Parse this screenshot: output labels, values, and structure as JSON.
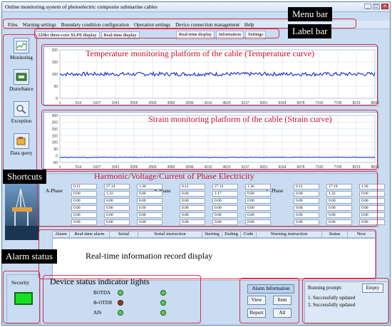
{
  "window": {
    "title": "Online monitoring system of photoelectric composite submarine cables",
    "buttons": [
      "_",
      "□",
      "×"
    ]
  },
  "menu": {
    "items": [
      "Files",
      "Warning settings",
      "Boundary condition configuration",
      "Operation settings",
      "Device connection management",
      "Help"
    ]
  },
  "tabs": {
    "items": [
      "220kv three-core XLPE display",
      "Real-time display"
    ],
    "items2": [
      "Real-time display",
      "Information",
      "Settings"
    ]
  },
  "sidebar": {
    "items": [
      {
        "label": "Monitoring",
        "icon": "monitoring-chart-icon"
      },
      {
        "label": "Disturbance",
        "icon": "disturbance-icon"
      },
      {
        "label": "Exception",
        "icon": "exception-magnifier-icon"
      },
      {
        "label": "Data query",
        "icon": "data-query-icon"
      }
    ]
  },
  "callouts": {
    "menu_bar": "Menu bar",
    "label_bar": "Label bar",
    "shortcuts": "Shortcuts",
    "alarm_status": "Alarm status",
    "realtime_record": "Real-time information record display",
    "device_lights": "Device status indicator lights"
  },
  "overlay_titles": {
    "temperature": "Temperature monitoring platform of the cable (Temperature curve)",
    "strain": "Strain monitoring platform of the cable (Strain curve)",
    "harmonic": "Harmonic/Voltage/Current of Phase Electricity"
  },
  "chart_data": [
    {
      "type": "line",
      "y_ticks": [
        "200",
        "150",
        "100",
        "50",
        "0"
      ],
      "ylim": [
        0,
        200
      ],
      "x_ticks": [
        "1",
        "514",
        "1027",
        "1541",
        "2055",
        "2569",
        "3082",
        "3596",
        "4110",
        "4623",
        "5137",
        "5651",
        "6164",
        "6678",
        "7192",
        "7705",
        "8219",
        "8830"
      ],
      "series": [
        {
          "color": "#1f2fd0",
          "level": 100,
          "spread": 8
        }
      ],
      "grid": true
    },
    {
      "type": "line",
      "y_ticks": [
        "300",
        "250",
        "200",
        "150",
        "100",
        "50",
        "0",
        "-50"
      ],
      "ylim": [
        -50,
        300
      ],
      "x_ticks": [
        "1",
        "514",
        "1027",
        "1541",
        "2055",
        "2569",
        "3082",
        "3596",
        "4110",
        "4623",
        "5137",
        "5651",
        "6164",
        "6678",
        "7192",
        "7705",
        "8219",
        "8830"
      ],
      "series": [
        {
          "color": "#1f2fd0",
          "level": -12,
          "spread": 2
        }
      ],
      "grid": true
    }
  ],
  "phases": {
    "labels": [
      "A-Phase",
      "B-Phase",
      "C-Phase"
    ],
    "a_col1": [
      "0.12",
      "0.00",
      "0.00",
      "0.00",
      "0.00",
      "0.00"
    ],
    "a_col2": [
      "27.14",
      "1.33",
      "0.00",
      "0.00",
      "0.00",
      "0.00"
    ],
    "a_col3": [
      "1.36",
      "0.00",
      "0.00",
      "0.00",
      "0.00",
      "0.00"
    ],
    "b_col1": [
      "0.12",
      "0.00",
      "0.00",
      "0.00",
      "0.00",
      "0.00"
    ],
    "b_col2": [
      "27.13",
      "1.17",
      "0.00",
      "0.00",
      "0.00",
      "0.00"
    ],
    "b_col3": [
      "1.36",
      "0.00",
      "0.00",
      "0.00",
      "0.00",
      "0.00"
    ],
    "c_col1": [
      "0.12",
      "0.00",
      "0.00",
      "0.00",
      "0.00",
      "0.00"
    ],
    "c_col2": [
      "27.19",
      "1.32",
      "0.00",
      "0.00",
      "0.00",
      "0.00"
    ],
    "c_col3": [
      "1.36",
      "0.00",
      "0.00",
      "0.00",
      "0.00",
      "0.00"
    ]
  },
  "alarm_table": {
    "columns": [
      "Alarm",
      "Real-time alarm",
      "Serial",
      "Serial instruction",
      "Starting",
      "Ending",
      "Code",
      "Warning instruction",
      "Status",
      "New"
    ]
  },
  "status": {
    "security_label": "Security",
    "devices": [
      "BOTDA",
      "Φ-OTDR",
      "AIS"
    ]
  },
  "controls": {
    "alarm_information": "Alarm Information",
    "view": "View",
    "item": "Item",
    "report": "Report",
    "all": "All"
  },
  "prompt": {
    "title": "Running prompt:",
    "empty": "Empty",
    "lines": [
      "1. Successfully updated",
      "2. Successfully updated"
    ]
  }
}
